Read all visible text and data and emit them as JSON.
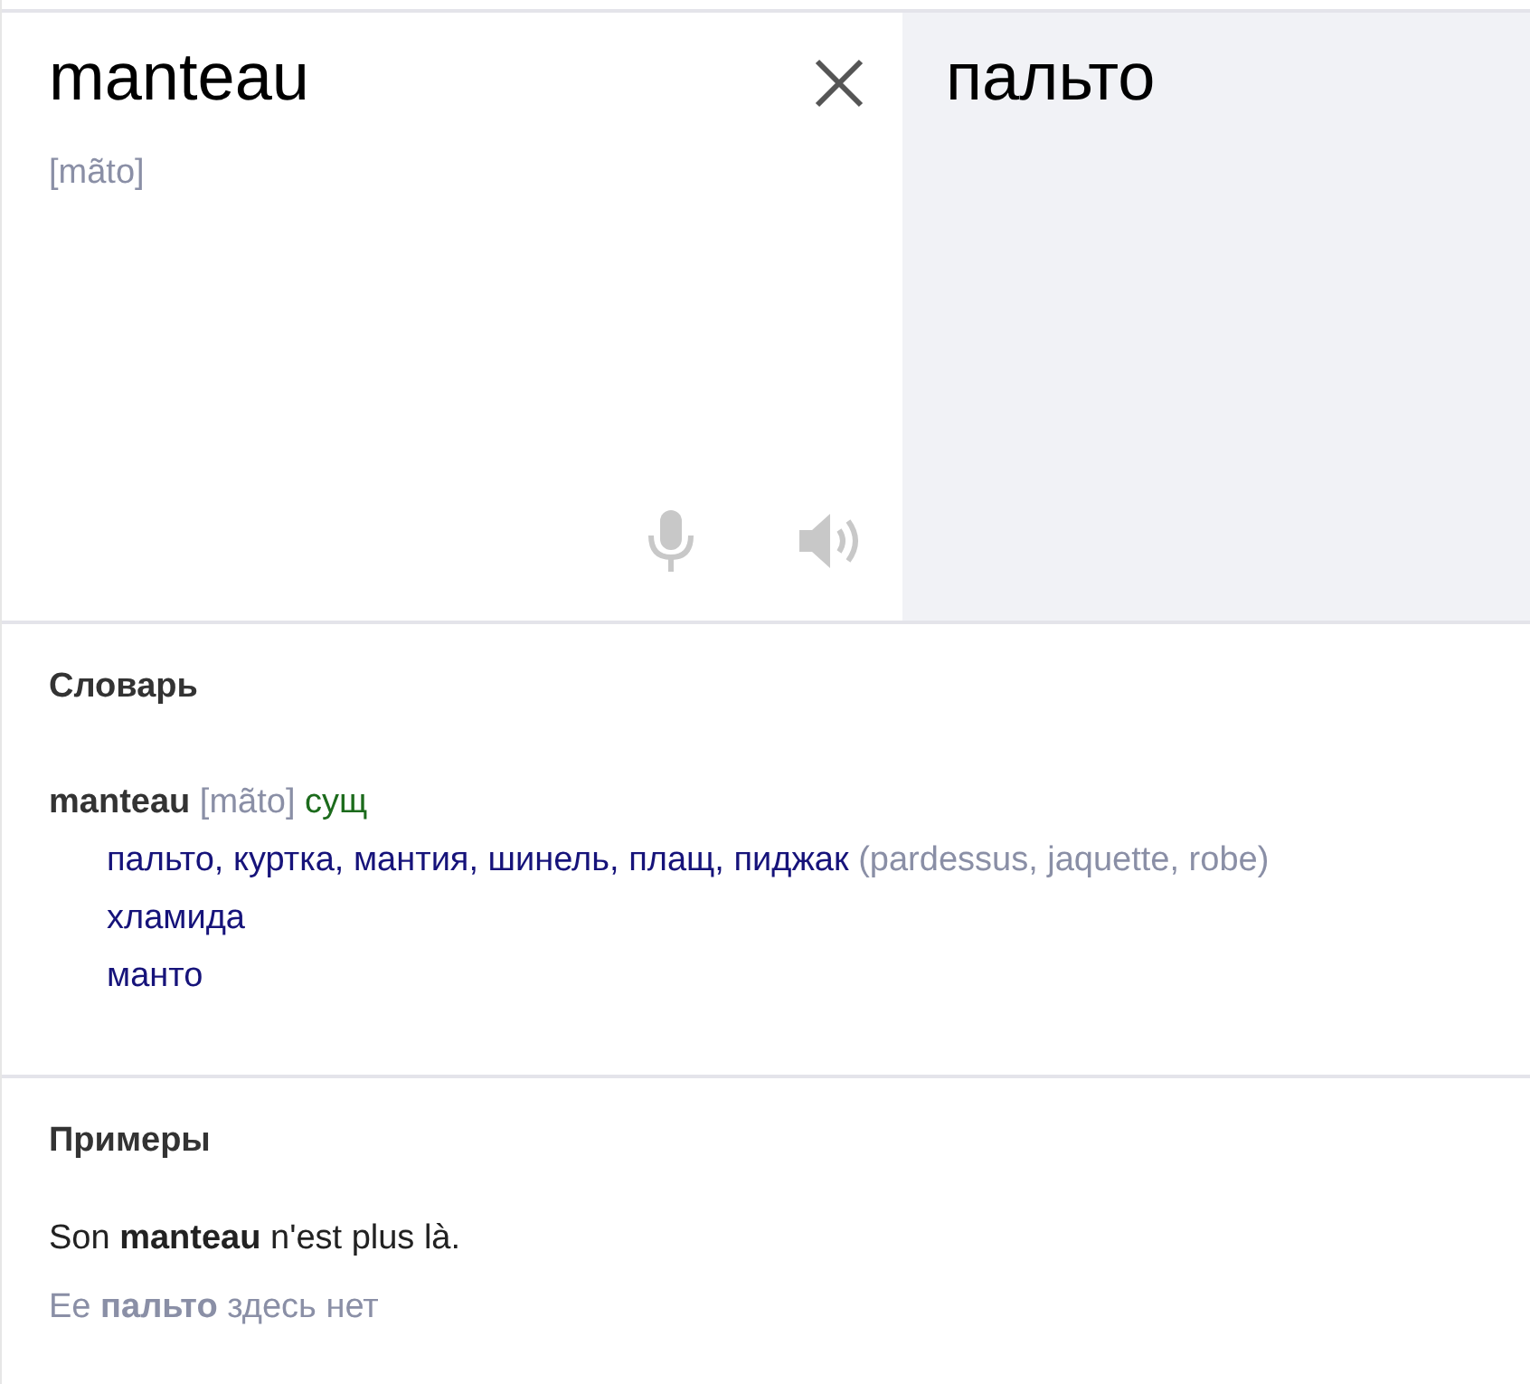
{
  "source": {
    "text": "manteau",
    "transcription": "[mãto]"
  },
  "translation": {
    "text": "пальто"
  },
  "dictionary": {
    "title": "Словарь",
    "entries": [
      {
        "word": "manteau",
        "transcription": "[mãto]",
        "part_of_speech": "сущ",
        "senses": [
          {
            "translations": "пальто, куртка, мантия, шинель, плащ, пиджак",
            "synonyms": "(pardessus, jaquette, robe)"
          },
          {
            "translations": "хламида"
          },
          {
            "translations": "манто"
          }
        ]
      }
    ]
  },
  "examples": {
    "title": "Примеры",
    "items": [
      {
        "source": "Son **manteau** n'est plus là.",
        "translation": "Ее **пальто** здесь нет"
      }
    ]
  }
}
